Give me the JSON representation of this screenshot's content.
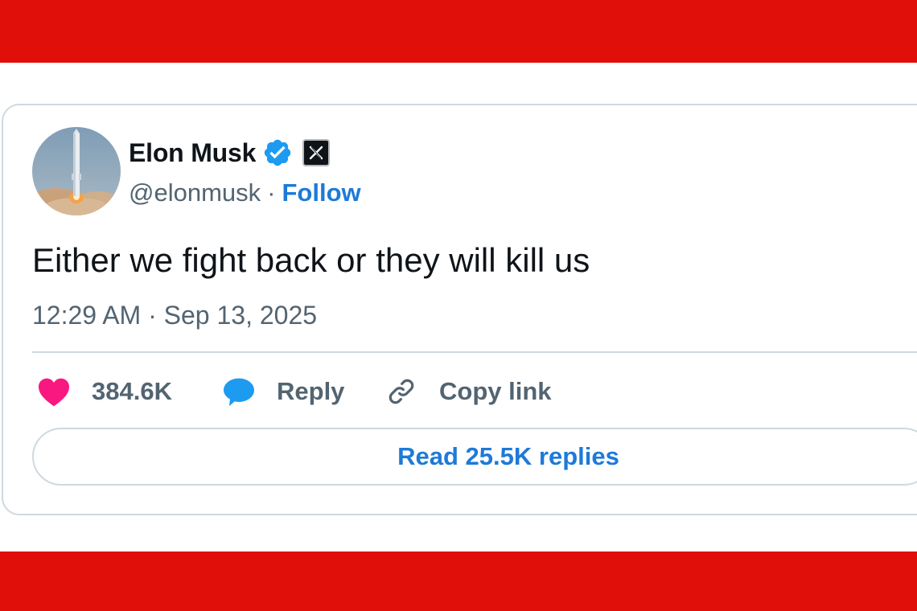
{
  "colors": {
    "band_red": "#e00f0a",
    "accent_blue": "#1d7ad8",
    "verified_blue": "#1d9bf0",
    "like_pink": "#f91880",
    "reply_blue": "#1d9bf0",
    "muted_text": "#536471",
    "primary_text": "#0f1419",
    "border": "#cfd9de"
  },
  "author": {
    "name": "Elon Musk",
    "handle": "@elonmusk",
    "separator": "·",
    "follow_label": "Follow",
    "avatar_icon": "rocket-launch-avatar",
    "verified_icon": "verified-badge-icon",
    "platform_icon": "x-logo-icon"
  },
  "tweet": {
    "text": "Either we fight back or they will kill us",
    "timestamp": "12:29 AM · Sep 13, 2025"
  },
  "actions": {
    "like": {
      "icon": "heart-icon",
      "label": "384.6K"
    },
    "reply": {
      "icon": "speech-bubble-icon",
      "label": "Reply"
    },
    "copy": {
      "icon": "link-icon",
      "label": "Copy link"
    }
  },
  "read_replies_label": "Read 25.5K replies"
}
